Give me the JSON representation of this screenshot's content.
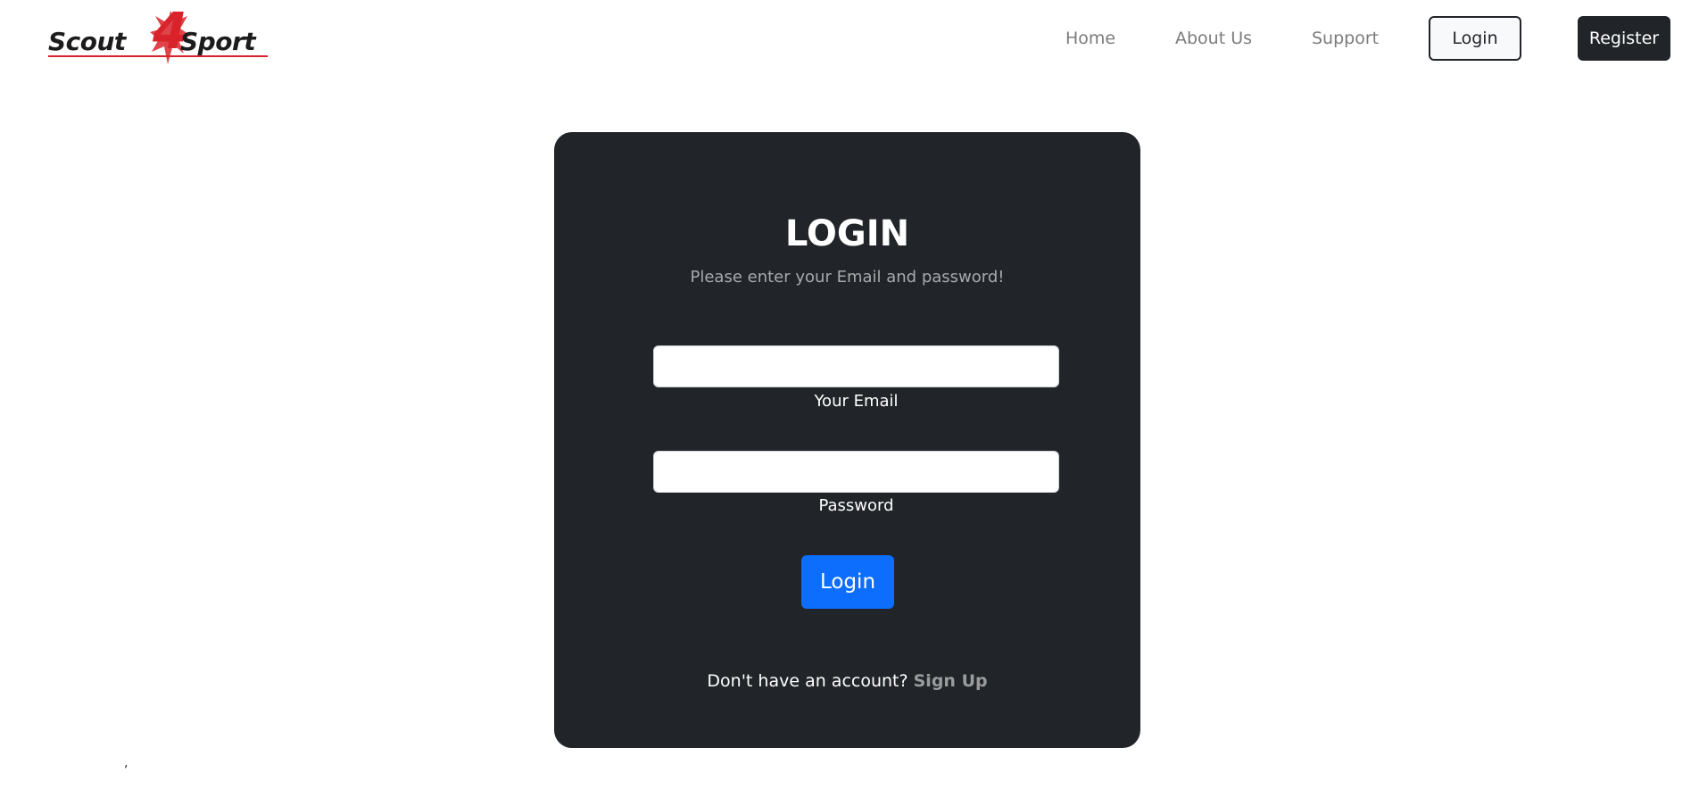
{
  "brand": {
    "logo_text_left": "Scout",
    "logo_digit": "4",
    "logo_text_right": "Sport",
    "accent_color": "#d8232a"
  },
  "nav": {
    "links": [
      "Home",
      "About Us",
      "Support"
    ],
    "login_label": "Login",
    "register_label": "Register"
  },
  "login_card": {
    "title": "LOGIN",
    "subtitle": "Please enter your Email and password!",
    "email_label": "Your Email",
    "email_value": "",
    "password_label": "Password",
    "password_value": "",
    "submit_label": "Login",
    "signup_prompt": "Don't have an account?",
    "signup_link": "Sign Up"
  },
  "footer": {
    "stray_text": ","
  },
  "colors": {
    "card_bg": "#212529",
    "primary": "#0d6efd",
    "dark": "#212529"
  }
}
